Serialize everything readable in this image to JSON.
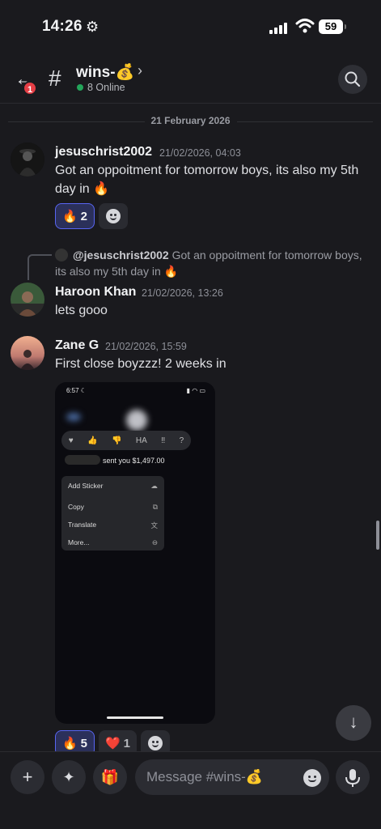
{
  "status": {
    "time": "14:26",
    "battery": "59"
  },
  "header": {
    "back_badge": "1",
    "channel_hash": "#",
    "channel_name": "wins-💰",
    "chevron": "›",
    "online": "8 Online"
  },
  "date_divider": "21 February 2026",
  "messages": [
    {
      "author": "jesuschrist2002",
      "timestamp": "21/02/2026, 04:03",
      "text": "Got an oppoitment for tomorrow boys, its also my 5th day in 🔥",
      "reactions": [
        {
          "emoji": "🔥",
          "count": "2"
        }
      ]
    },
    {
      "reply_mention": "@jesuschrist2002",
      "reply_text": "Got an oppoitment for tomorrow boys, its also my 5th day in 🔥",
      "author": "Haroon Khan",
      "timestamp": "21/02/2026, 13:26",
      "text": "lets gooo"
    },
    {
      "author": "Zane G",
      "timestamp": "21/02/2026, 15:59",
      "text": "First close boyzzz! 2 weeks in",
      "attachment": {
        "time": "6:57",
        "sent_text": "sent you $1,497.00",
        "menu": [
          "Add Sticker",
          "Copy",
          "Translate",
          "More..."
        ]
      },
      "reactions": [
        {
          "emoji": "🔥",
          "count": "5"
        },
        {
          "emoji": "❤️",
          "count": "1"
        }
      ]
    }
  ],
  "composer": {
    "placeholder": "Message #wins-💰"
  }
}
